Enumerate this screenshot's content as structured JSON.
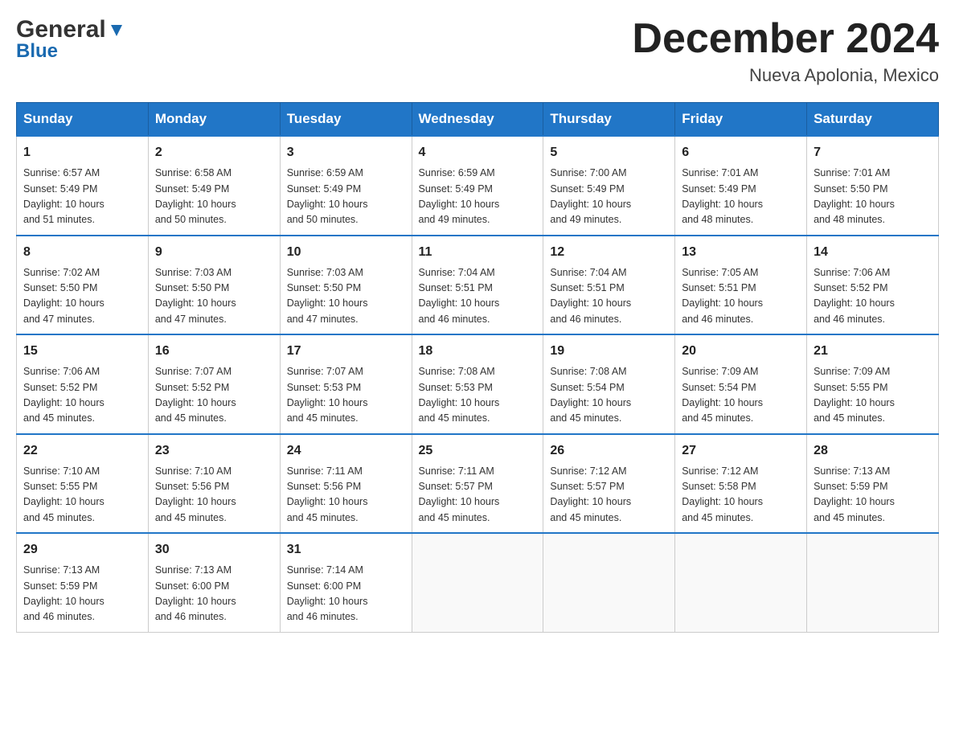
{
  "header": {
    "logo_general": "General",
    "logo_blue": "Blue",
    "month_year": "December 2024",
    "location": "Nueva Apolonia, Mexico"
  },
  "days_of_week": [
    "Sunday",
    "Monday",
    "Tuesday",
    "Wednesday",
    "Thursday",
    "Friday",
    "Saturday"
  ],
  "weeks": [
    [
      {
        "day": "1",
        "info": "Sunrise: 6:57 AM\nSunset: 5:49 PM\nDaylight: 10 hours\nand 51 minutes."
      },
      {
        "day": "2",
        "info": "Sunrise: 6:58 AM\nSunset: 5:49 PM\nDaylight: 10 hours\nand 50 minutes."
      },
      {
        "day": "3",
        "info": "Sunrise: 6:59 AM\nSunset: 5:49 PM\nDaylight: 10 hours\nand 50 minutes."
      },
      {
        "day": "4",
        "info": "Sunrise: 6:59 AM\nSunset: 5:49 PM\nDaylight: 10 hours\nand 49 minutes."
      },
      {
        "day": "5",
        "info": "Sunrise: 7:00 AM\nSunset: 5:49 PM\nDaylight: 10 hours\nand 49 minutes."
      },
      {
        "day": "6",
        "info": "Sunrise: 7:01 AM\nSunset: 5:49 PM\nDaylight: 10 hours\nand 48 minutes."
      },
      {
        "day": "7",
        "info": "Sunrise: 7:01 AM\nSunset: 5:50 PM\nDaylight: 10 hours\nand 48 minutes."
      }
    ],
    [
      {
        "day": "8",
        "info": "Sunrise: 7:02 AM\nSunset: 5:50 PM\nDaylight: 10 hours\nand 47 minutes."
      },
      {
        "day": "9",
        "info": "Sunrise: 7:03 AM\nSunset: 5:50 PM\nDaylight: 10 hours\nand 47 minutes."
      },
      {
        "day": "10",
        "info": "Sunrise: 7:03 AM\nSunset: 5:50 PM\nDaylight: 10 hours\nand 47 minutes."
      },
      {
        "day": "11",
        "info": "Sunrise: 7:04 AM\nSunset: 5:51 PM\nDaylight: 10 hours\nand 46 minutes."
      },
      {
        "day": "12",
        "info": "Sunrise: 7:04 AM\nSunset: 5:51 PM\nDaylight: 10 hours\nand 46 minutes."
      },
      {
        "day": "13",
        "info": "Sunrise: 7:05 AM\nSunset: 5:51 PM\nDaylight: 10 hours\nand 46 minutes."
      },
      {
        "day": "14",
        "info": "Sunrise: 7:06 AM\nSunset: 5:52 PM\nDaylight: 10 hours\nand 46 minutes."
      }
    ],
    [
      {
        "day": "15",
        "info": "Sunrise: 7:06 AM\nSunset: 5:52 PM\nDaylight: 10 hours\nand 45 minutes."
      },
      {
        "day": "16",
        "info": "Sunrise: 7:07 AM\nSunset: 5:52 PM\nDaylight: 10 hours\nand 45 minutes."
      },
      {
        "day": "17",
        "info": "Sunrise: 7:07 AM\nSunset: 5:53 PM\nDaylight: 10 hours\nand 45 minutes."
      },
      {
        "day": "18",
        "info": "Sunrise: 7:08 AM\nSunset: 5:53 PM\nDaylight: 10 hours\nand 45 minutes."
      },
      {
        "day": "19",
        "info": "Sunrise: 7:08 AM\nSunset: 5:54 PM\nDaylight: 10 hours\nand 45 minutes."
      },
      {
        "day": "20",
        "info": "Sunrise: 7:09 AM\nSunset: 5:54 PM\nDaylight: 10 hours\nand 45 minutes."
      },
      {
        "day": "21",
        "info": "Sunrise: 7:09 AM\nSunset: 5:55 PM\nDaylight: 10 hours\nand 45 minutes."
      }
    ],
    [
      {
        "day": "22",
        "info": "Sunrise: 7:10 AM\nSunset: 5:55 PM\nDaylight: 10 hours\nand 45 minutes."
      },
      {
        "day": "23",
        "info": "Sunrise: 7:10 AM\nSunset: 5:56 PM\nDaylight: 10 hours\nand 45 minutes."
      },
      {
        "day": "24",
        "info": "Sunrise: 7:11 AM\nSunset: 5:56 PM\nDaylight: 10 hours\nand 45 minutes."
      },
      {
        "day": "25",
        "info": "Sunrise: 7:11 AM\nSunset: 5:57 PM\nDaylight: 10 hours\nand 45 minutes."
      },
      {
        "day": "26",
        "info": "Sunrise: 7:12 AM\nSunset: 5:57 PM\nDaylight: 10 hours\nand 45 minutes."
      },
      {
        "day": "27",
        "info": "Sunrise: 7:12 AM\nSunset: 5:58 PM\nDaylight: 10 hours\nand 45 minutes."
      },
      {
        "day": "28",
        "info": "Sunrise: 7:13 AM\nSunset: 5:59 PM\nDaylight: 10 hours\nand 45 minutes."
      }
    ],
    [
      {
        "day": "29",
        "info": "Sunrise: 7:13 AM\nSunset: 5:59 PM\nDaylight: 10 hours\nand 46 minutes."
      },
      {
        "day": "30",
        "info": "Sunrise: 7:13 AM\nSunset: 6:00 PM\nDaylight: 10 hours\nand 46 minutes."
      },
      {
        "day": "31",
        "info": "Sunrise: 7:14 AM\nSunset: 6:00 PM\nDaylight: 10 hours\nand 46 minutes."
      },
      {
        "day": "",
        "info": ""
      },
      {
        "day": "",
        "info": ""
      },
      {
        "day": "",
        "info": ""
      },
      {
        "day": "",
        "info": ""
      }
    ]
  ]
}
